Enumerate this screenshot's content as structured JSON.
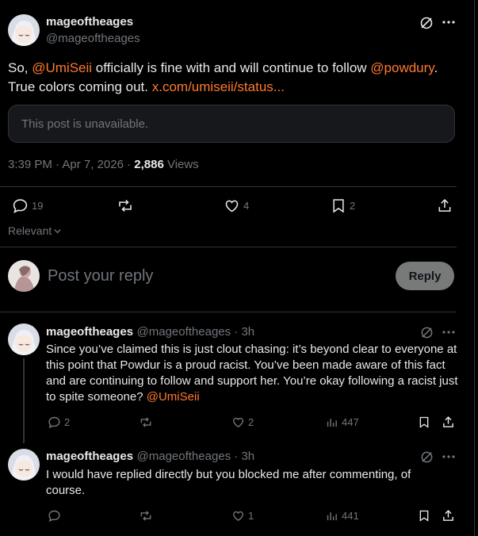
{
  "main_post": {
    "author_name": "mageoftheages",
    "author_handle": "@mageoftheages",
    "text_prefix": "So, ",
    "mention_1": "@UmiSeii",
    "text_mid": " officially is fine with and will continue to follow ",
    "mention_2": "@powdury",
    "text_period": ".",
    "text_line2": "True colors coming out. ",
    "link_text": "x.com/umiseii/status...",
    "quote_unavailable": "This post is unavailable.",
    "time": "3:39 PM · Apr 7, 2026 · ",
    "views_count": "2,886",
    "views_label": " Views",
    "replies": "19",
    "likes": "4",
    "bookmarks": "2"
  },
  "sort_label": "Relevant",
  "composer": {
    "placeholder": "Post your reply",
    "reply_button": "Reply"
  },
  "replies": [
    {
      "author_name": "mageoftheages",
      "author_handle": "@mageoftheages · 3h",
      "text": "Since you’ve claimed this is just clout chasing: it’s beyond clear to everyone at this point that Powdur is a proud racist. You’ve been made aware of this fact and are continuing to follow and support her. You’re okay following a racist just to spite someone? ",
      "mention": "@UmiSeii",
      "replies": "2",
      "likes": "2",
      "views": "447"
    },
    {
      "author_name": "mageoftheages",
      "author_handle": "@mageoftheages · 3h",
      "text": "I would have replied directly but you blocked me after commenting, of course.",
      "replies": "",
      "likes": "1",
      "views": "441"
    }
  ],
  "colors": {
    "accent": "#ff7a2e",
    "muted": "#71767b",
    "text": "#e7e9ea",
    "border": "#2f3336"
  }
}
